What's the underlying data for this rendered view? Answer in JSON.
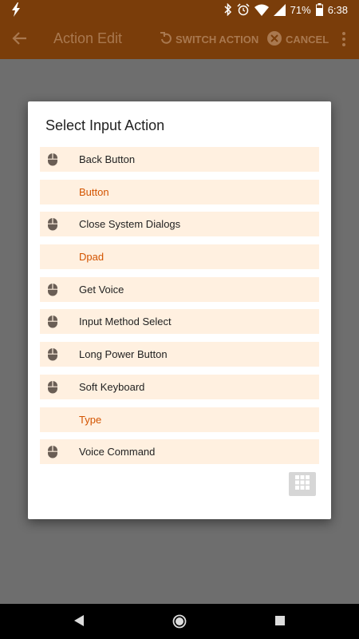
{
  "status_bar": {
    "battery": "71%",
    "time": "6:38",
    "icons": [
      "bolt-icon",
      "bluetooth-icon",
      "alarm-icon",
      "wifi-icon",
      "signal-icon",
      "battery-icon"
    ]
  },
  "app_bar": {
    "title": "Action Edit",
    "switch_action_label": "SWITCH ACTION",
    "cancel_label": "CANCEL",
    "icons": [
      "back-arrow-icon",
      "refresh-icon",
      "cancel-icon",
      "more-vert-icon"
    ]
  },
  "dialog": {
    "title": "Select Input Action",
    "items": [
      {
        "label": "Back Button",
        "kind": "action",
        "icon": "mouse-icon"
      },
      {
        "label": "Button",
        "kind": "category",
        "icon": ""
      },
      {
        "label": "Close System Dialogs",
        "kind": "action",
        "icon": "mouse-icon"
      },
      {
        "label": "Dpad",
        "kind": "category",
        "icon": ""
      },
      {
        "label": "Get Voice",
        "kind": "action",
        "icon": "mouse-icon"
      },
      {
        "label": "Input Method Select",
        "kind": "action",
        "icon": "mouse-icon"
      },
      {
        "label": "Long Power Button",
        "kind": "action",
        "icon": "mouse-icon"
      },
      {
        "label": "Soft Keyboard",
        "kind": "action",
        "icon": "mouse-icon"
      },
      {
        "label": "Type",
        "kind": "category",
        "icon": ""
      },
      {
        "label": "Voice Command",
        "kind": "action",
        "icon": "mouse-icon"
      }
    ],
    "grid_button_icon": "grid-icon"
  },
  "nav_bar": {
    "icons": [
      "nav-back-icon",
      "nav-home-icon",
      "nav-recents-icon"
    ]
  },
  "colors": {
    "app_bar": "#7a3d0a",
    "item_background": "#fff0e0",
    "category_text": "#d35400",
    "scrim": "#6e6e6e"
  }
}
